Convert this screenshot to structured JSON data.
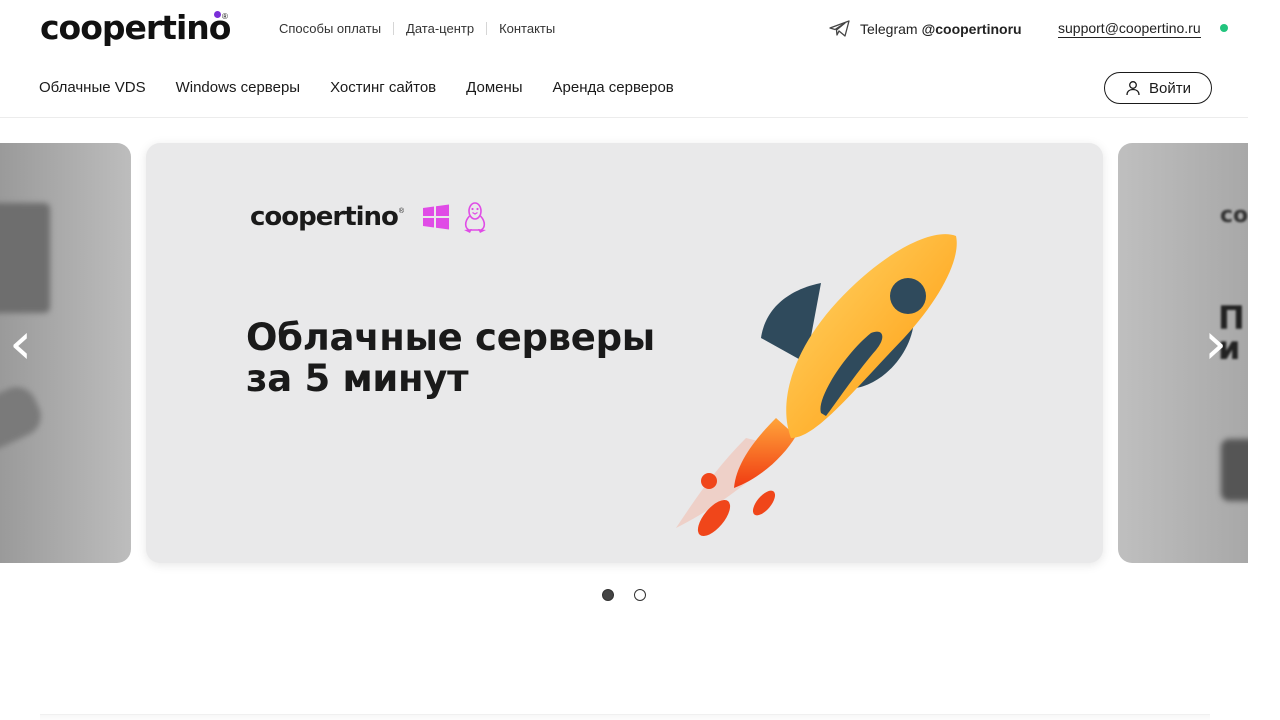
{
  "header": {
    "logo_text": "coopertino",
    "logo_reg": "®",
    "top_links": [
      "Способы оплаты",
      "Дата-центр",
      "Контакты"
    ],
    "telegram_label": "Telegram",
    "telegram_handle": "@coopertinoru",
    "support_email": "support@coopertino.ru",
    "online_color": "#22c47d",
    "accent_color": "#7b2fd9"
  },
  "nav": {
    "items": [
      "Облачные VDS",
      "Windows серверы",
      "Хостинг сайтов",
      "Домены",
      "Аренда серверов"
    ],
    "login_label": "Войти"
  },
  "carousel": {
    "prev_arrow": "‹",
    "next_arrow": "›",
    "active_slide": 1,
    "total_slides": 2,
    "slide": {
      "logo_text": "coopertino",
      "logo_reg": "®",
      "headline": "Облачные серверы\nза 5 минут",
      "os_icons": [
        "windows-icon",
        "linux-tux-icon"
      ],
      "icon_color": "#e04ce6"
    },
    "right_peek_text": "co",
    "right_peek_text2": "П\nи"
  },
  "icons": {
    "telegram": "telegram-icon",
    "user": "user-icon",
    "rocket": "rocket-illustration"
  }
}
